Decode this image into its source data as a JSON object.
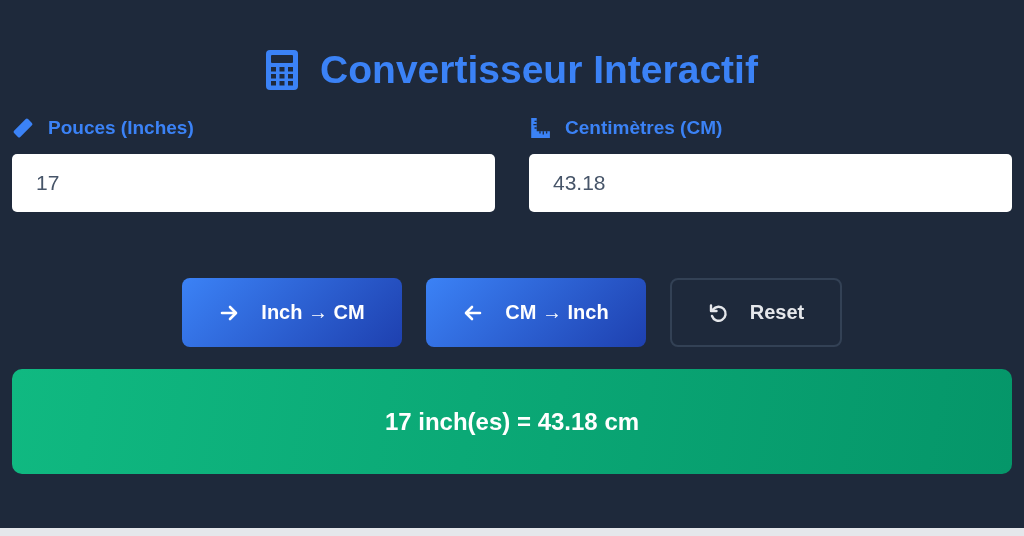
{
  "title": "Convertisseur Interactif",
  "fields": [
    {
      "label": "Pouces (Inches)",
      "value": "17"
    },
    {
      "label": "Centimètres (CM)",
      "value": "43.18"
    }
  ],
  "buttons": [
    {
      "label": "Inch → CM",
      "kind": "forward"
    },
    {
      "label": "CM → Inch",
      "kind": "backward"
    },
    {
      "label": "Reset",
      "kind": "reset"
    }
  ],
  "result": "17 inch(es) = 43.18 cm"
}
